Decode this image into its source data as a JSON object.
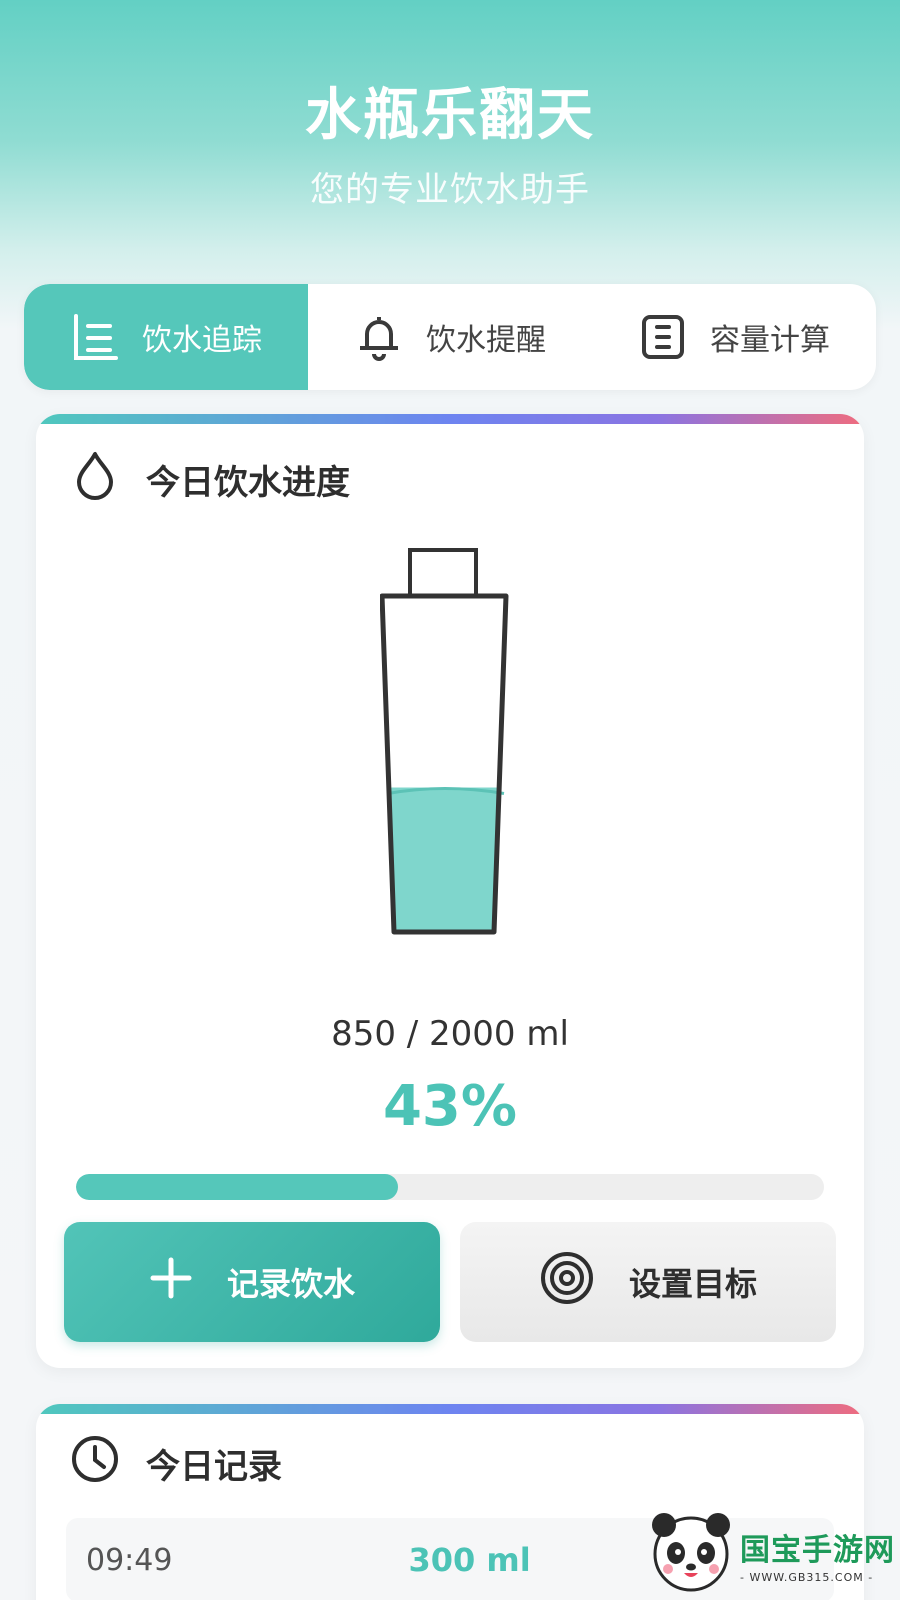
{
  "header": {
    "title": "水瓶乐翻天",
    "subtitle": "您的专业饮水助手"
  },
  "tabs": [
    {
      "label": "饮水追踪",
      "icon": "list-chart-icon",
      "active": true
    },
    {
      "label": "饮水提醒",
      "icon": "bell-icon",
      "active": false
    },
    {
      "label": "容量计算",
      "icon": "calculator-icon",
      "active": false
    }
  ],
  "progress_card": {
    "title": "今日饮水进度",
    "icon": "water-drop-icon",
    "current_ml": 850,
    "goal_ml": 2000,
    "amount_text": "850 / 2000 ml",
    "percent_text": "43%",
    "fill_fraction": 0.43,
    "record_button": "记录饮水",
    "goal_button": "设置目标"
  },
  "records_card": {
    "title": "今日记录",
    "icon": "clock-icon",
    "items": [
      {
        "time": "09:49",
        "amount": "300 ml"
      }
    ]
  },
  "watermark": {
    "name": "国宝手游网",
    "url": "- WWW.GB315.COM -"
  },
  "colors": {
    "accent": "#55c7ba",
    "accent_dark": "#2fa99b",
    "header_top": "#63d0c4",
    "gradient_bar": [
      "#4fc8bd",
      "#6d84f0",
      "#ef6c7e"
    ]
  }
}
